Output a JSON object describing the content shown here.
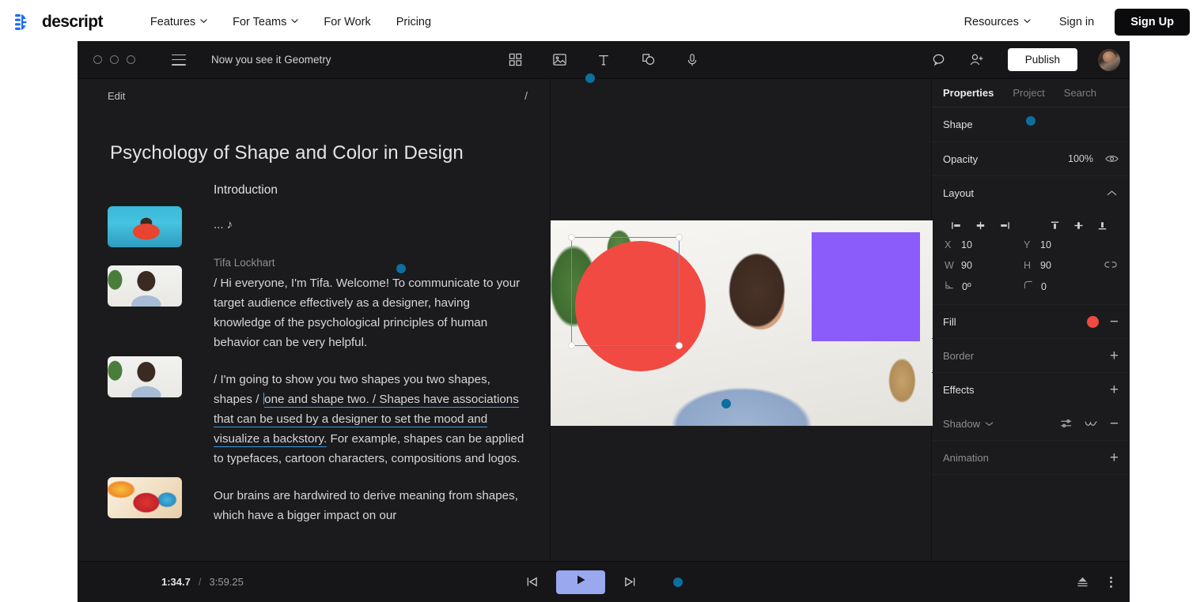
{
  "site_nav": {
    "brand": "descript",
    "links": [
      {
        "label": "Features",
        "has_chevron": true
      },
      {
        "label": "For Teams",
        "has_chevron": true
      },
      {
        "label": "For Work",
        "has_chevron": false
      },
      {
        "label": "Pricing",
        "has_chevron": false
      }
    ],
    "right_links": [
      {
        "label": "Resources",
        "has_chevron": true
      },
      {
        "label": "Sign in",
        "has_chevron": false
      }
    ],
    "signup_label": "Sign Up",
    "signup_bg": "#0b0b0d"
  },
  "app": {
    "toolbar": {
      "project_title": "Now you see it Geometry",
      "menu_icon": "hamburger-icon",
      "center_icons": [
        "grid-icon",
        "image-icon",
        "text-icon",
        "shapes-icon",
        "microphone-icon"
      ],
      "right_icons": [
        "comment-icon",
        "add-person-icon"
      ],
      "publish_label": "Publish"
    },
    "doc": {
      "mode_label": "Edit",
      "slash_label": "/",
      "title": "Psychology of Shape and Color in Design",
      "section_heading": "Introduction",
      "ellipsis_line": "... ♪",
      "speaker": "Tifa Lockhart",
      "paragraph_1": "/ Hi everyone, I'm Tifa. Welcome! To communicate to your target audience effectively as a designer, having knowledge of the psychological principles of human behavior can be very helpful.",
      "paragraph_2_pre": "/ I'm going to show you two shapes you two shapes, shapes / ",
      "paragraph_2_highlight": "one and shape two. / Shapes have associations that can be used by a designer to set the mood and visualize a backstory.",
      "paragraph_2_post": " For example, shapes can be applied to typefaces, cartoon characters, compositions and logos.",
      "paragraph_3": "Our brains are hardwired to derive meaning from shapes, which have a bigger impact on our",
      "highlight_color": "#3b9ae1",
      "thumbnails": [
        "pool-selfie-thumbnail",
        "person-waving-thumbnail",
        "person-smiling-thumbnail",
        "abstract-art-thumbnail"
      ]
    },
    "canvas": {
      "circle_color": "#f04a42",
      "square_color": "#8b5cfa",
      "selection_color": "#3b9ae1",
      "video_alt": "person-smiling-video-frame"
    },
    "properties": {
      "tabs": [
        {
          "label": "Properties",
          "active": true
        },
        {
          "label": "Project",
          "active": false
        },
        {
          "label": "Search",
          "active": false
        }
      ],
      "shape_label": "Shape",
      "opacity_label": "Opacity",
      "opacity_value": "100%",
      "layout_label": "Layout",
      "align_icons": [
        "align-left-icon",
        "align-center-horizontal-icon",
        "align-right-icon",
        "align-top-icon",
        "align-center-vertical-icon",
        "align-bottom-icon"
      ],
      "x_key": "X",
      "x_value": "10",
      "y_key": "Y",
      "y_value": "10",
      "w_key": "W",
      "w_value": "90",
      "h_key": "H",
      "h_value": "90",
      "rotation_value": "0º",
      "corner_value": "0",
      "fill_label": "Fill",
      "fill_color": "#f04a42",
      "border_label": "Border",
      "effects_label": "Effects",
      "shadow_label": "Shadow",
      "animation_label": "Animation"
    },
    "timeline": {
      "current_time": "1:34.7",
      "separator": "/",
      "total_time": "3:59.25",
      "prev_icon": "skip-previous-icon",
      "play_icon": "play-icon",
      "next_icon": "skip-next-icon",
      "play_bg": "#9aa8ef",
      "right_icons": [
        "export-icon",
        "more-options-icon"
      ]
    }
  }
}
